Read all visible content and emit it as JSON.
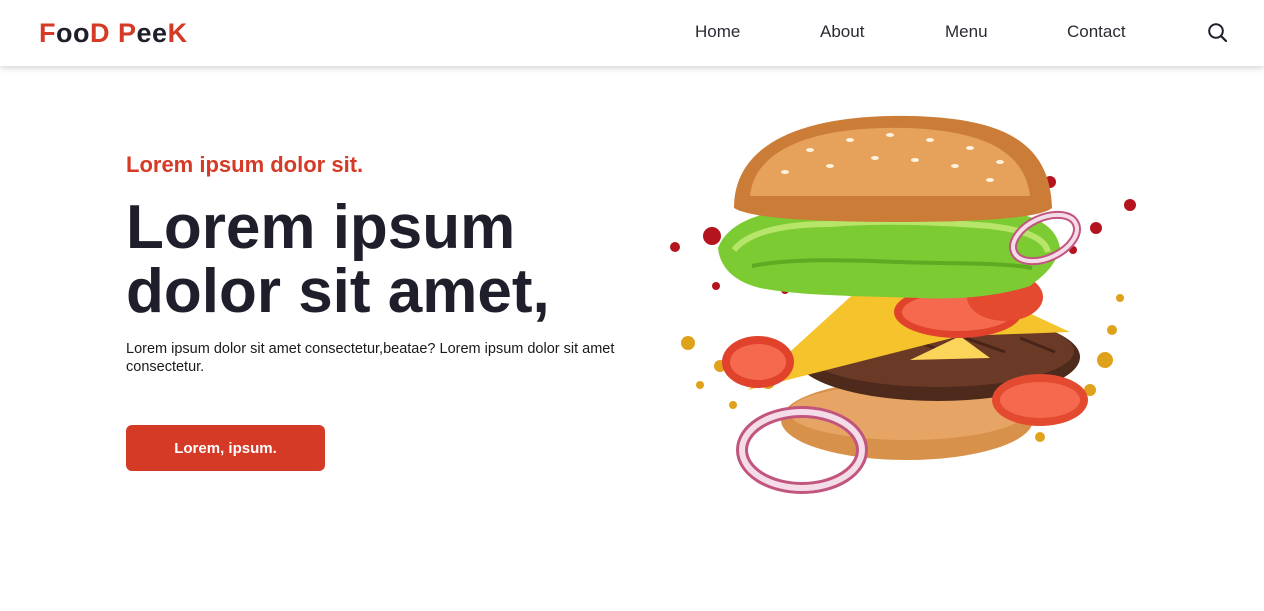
{
  "nav": {
    "logo": {
      "p1": "F",
      "p2": "oo",
      "p3": "D",
      "p4": " ",
      "p5": "P",
      "p6": "ee",
      "p7": "K"
    },
    "links": [
      "Home",
      "About",
      "Menu",
      "Contact"
    ],
    "search_icon": "search-icon"
  },
  "hero": {
    "kicker": "Lorem ipsum dolor sit.",
    "headline": "Lorem ipsum dolor sit amet,",
    "description": "Lorem ipsum dolor sit amet consectetur,beatae? Lorem ipsum dolor sit amet consectetur.",
    "cta_label": "Lorem, ipsum.",
    "image": "burger-image"
  },
  "colors": {
    "accent": "#d43a26",
    "text_dark": "#1f1e2b",
    "background": "#ffffff"
  }
}
